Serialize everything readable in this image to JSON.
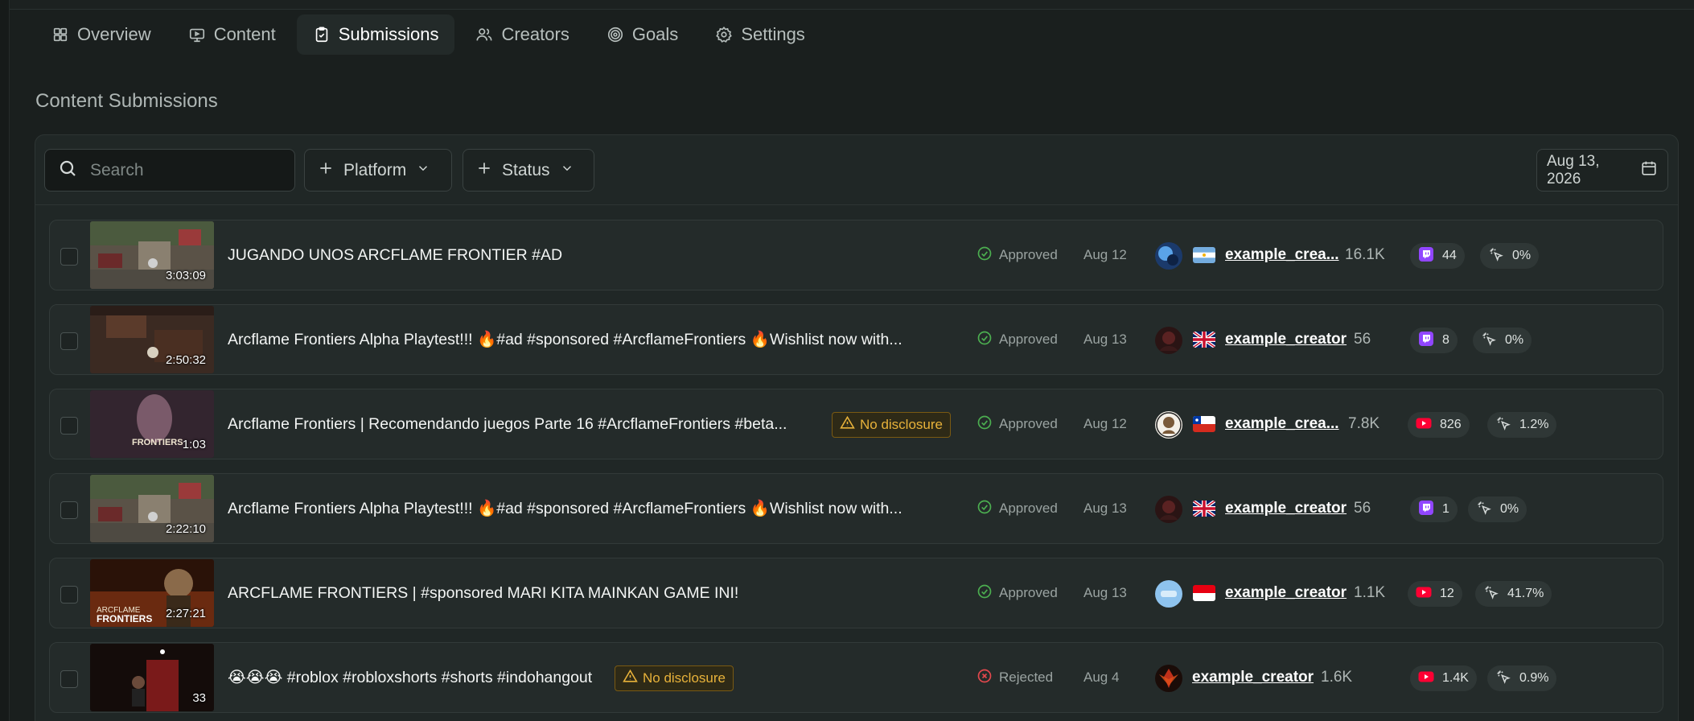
{
  "tabs": [
    {
      "label": "Overview",
      "icon": "grid-icon"
    },
    {
      "label": "Content",
      "icon": "monitor-icon"
    },
    {
      "label": "Submissions",
      "icon": "clipboard-icon",
      "active": true
    },
    {
      "label": "Creators",
      "icon": "users-icon"
    },
    {
      "label": "Goals",
      "icon": "target-icon"
    },
    {
      "label": "Settings",
      "icon": "gear-icon"
    }
  ],
  "section_title": "Content Submissions",
  "filters": {
    "search_placeholder": "Search",
    "platform_label": "Platform",
    "status_label": "Status",
    "date_label": "Aug 13, 2026"
  },
  "submissions": [
    {
      "title": "JUGANDO UNOS ARCFLAME FRONTIER #AD",
      "duration": "3:03:09",
      "disclosure": "",
      "status": "Approved",
      "date": "Aug 12",
      "flag": "AR",
      "creator": "example_crea...",
      "followers": "16.1K",
      "platform": "twitch",
      "views": "44",
      "engagement": "0%"
    },
    {
      "title": "Arcflame Frontiers Alpha Playtest!!! 🔥#ad #sponsored #ArcflameFrontiers 🔥Wishlist now with...",
      "duration": "2:50:32",
      "disclosure": "",
      "status": "Approved",
      "date": "Aug 13",
      "flag": "GB",
      "creator": "example_creator",
      "followers": "56",
      "platform": "twitch",
      "views": "8",
      "engagement": "0%"
    },
    {
      "title": "Arcflame Frontiers | Recomendando juegos Parte 16 #ArcflameFrontiers #beta...",
      "duration": "1:03",
      "disclosure": "No disclosure",
      "status": "Approved",
      "date": "Aug 12",
      "flag": "CL",
      "creator": "example_crea...",
      "followers": "7.8K",
      "platform": "youtube",
      "views": "826",
      "engagement": "1.2%"
    },
    {
      "title": "Arcflame Frontiers Alpha Playtest!!! 🔥#ad #sponsored #ArcflameFrontiers 🔥Wishlist now with...",
      "duration": "2:22:10",
      "disclosure": "",
      "status": "Approved",
      "date": "Aug 13",
      "flag": "GB",
      "creator": "example_creator",
      "followers": "56",
      "platform": "twitch",
      "views": "1",
      "engagement": "0%"
    },
    {
      "title": "ARCFLAME FRONTIERS | #sponsored MARI KITA MAINKAN GAME INI!",
      "duration": "2:27:21",
      "disclosure": "",
      "status": "Approved",
      "date": "Aug 13",
      "flag": "ID",
      "creator": "example_creator",
      "followers": "1.1K",
      "platform": "youtube",
      "views": "12",
      "engagement": "41.7%"
    },
    {
      "title": "😭😭😭 #roblox #robloxshorts #shorts #indohangout",
      "duration": "33",
      "disclosure": "No disclosure",
      "status": "Rejected",
      "date": "Aug 4",
      "flag": "",
      "creator": "example_creator",
      "followers": "1.6K",
      "platform": "youtube",
      "views": "1.4K",
      "engagement": "0.9%"
    }
  ],
  "colors": {
    "approved": "#4caf50",
    "rejected": "#e5484d",
    "warning": "#e8b23a",
    "twitch": "#9146ff",
    "youtube": "#ff0033"
  }
}
